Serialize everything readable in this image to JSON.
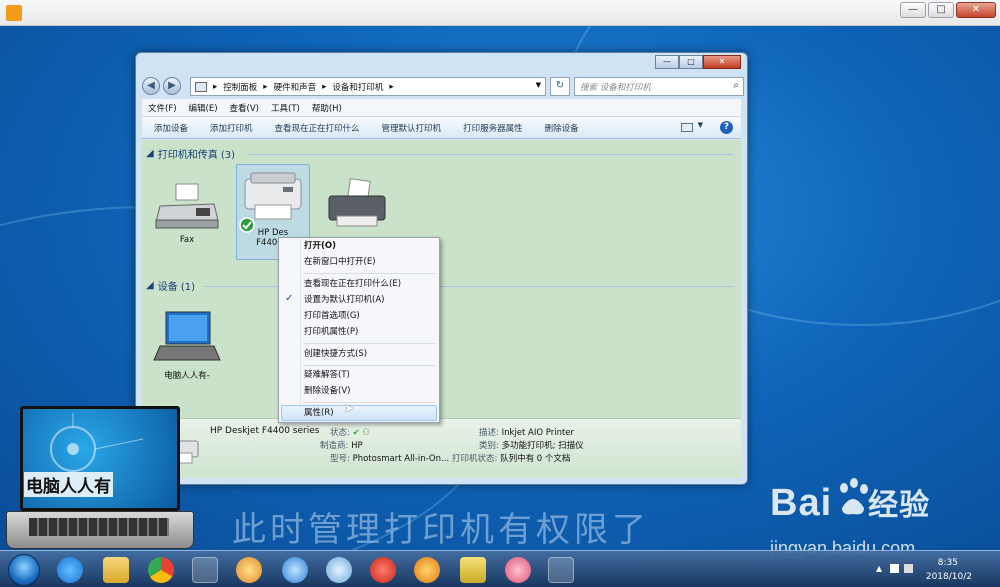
{
  "explorer": {
    "breadcrumb": [
      "控制面板",
      "硬件和声音",
      "设备和打印机"
    ],
    "search_placeholder": "搜索 设备和打印机",
    "menu": [
      "文件(F)",
      "编辑(E)",
      "查看(V)",
      "工具(T)",
      "帮助(H)"
    ],
    "toolbar": [
      "添加设备",
      "添加打印机",
      "查看现在正在打印什么",
      "管理默认打印机",
      "打印服务器属性",
      "删除设备"
    ],
    "printers_header": "打印机和传真 (3)",
    "devices_header": "设备 (1)",
    "printers": [
      "Fax",
      "HP Des",
      "F4400 s"
    ],
    "devices": [
      "电脑人人有-"
    ],
    "details": {
      "name": "HP Deskjet F4400 series",
      "status_label": "状态:",
      "manufacturer_label": "制造商:",
      "manufacturer": "HP",
      "model_label": "型号:",
      "model": "Photosmart All-in-On...",
      "description_label": "描述:",
      "description": "Inkjet AIO Printer",
      "category_label": "类别:",
      "category": "多功能打印机; 扫描仪",
      "print_status_label": "打印机状态:",
      "print_status": "队列中有 0 个文档"
    }
  },
  "context_menu": {
    "open": "打开(O)",
    "open_new": "在新窗口中打开(E)",
    "see_printing": "查看现在正在打印什么(E)",
    "set_default": "设置为默认打印机(A)",
    "preferences": "打印首选项(G)",
    "printer_props": "打印机属性(P)",
    "shortcut": "创建快捷方式(S)",
    "troubleshoot": "疑难解答(T)",
    "remove": "删除设备(V)",
    "properties": "属性(R)"
  },
  "overlay": {
    "caption": "此时管理打印机有权限了",
    "logo_text": "电脑人人有",
    "baidu_brand": "Bai",
    "baidu_brand2": "经验",
    "baidu_url": "jingyan.baidu.com"
  },
  "taskbar": {
    "time": "8:35",
    "date": "2018/10/2"
  }
}
